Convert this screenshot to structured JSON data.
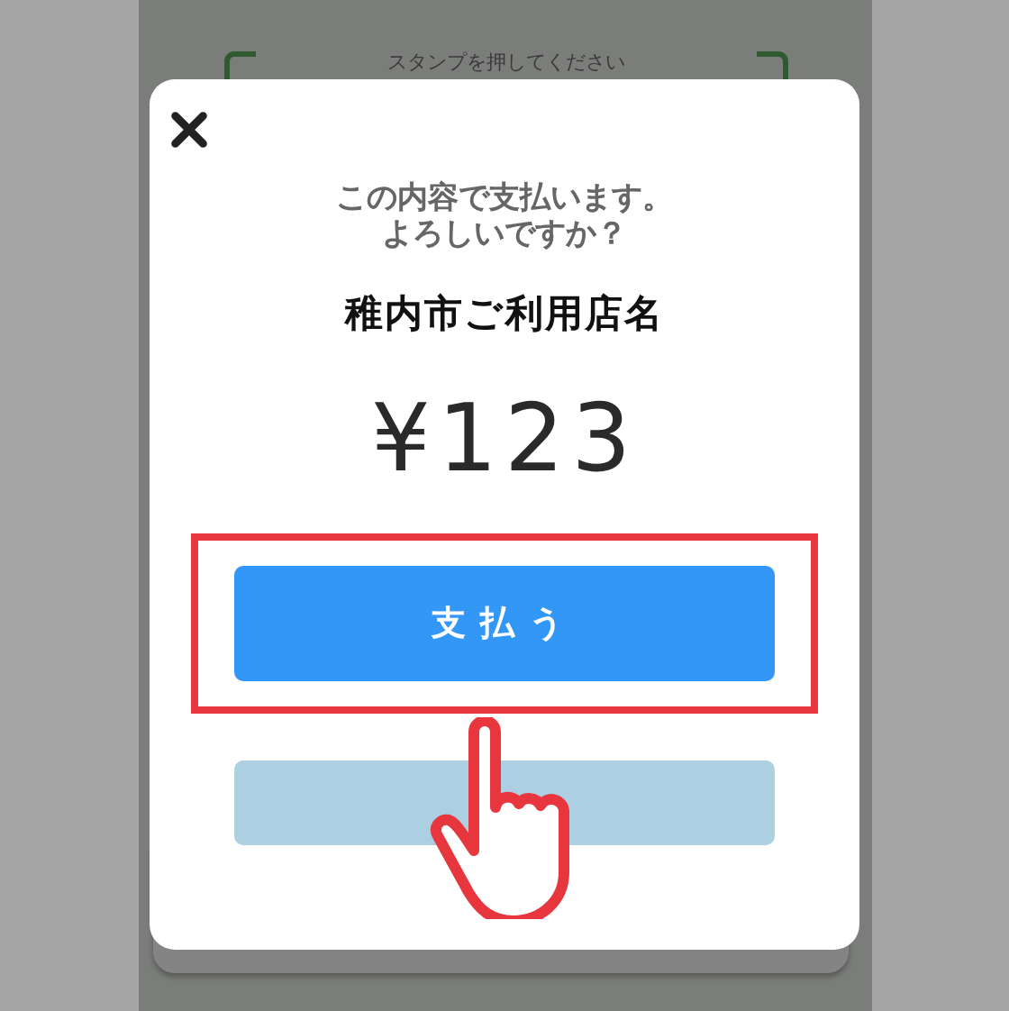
{
  "background": {
    "stamp_prompt": "スタンプを押してください"
  },
  "dialog": {
    "message_lines": [
      "この内容で支払います。",
      "よろしいですか？"
    ],
    "store_name": "稚内市ご利用店名",
    "amount": "¥123",
    "buttons": [
      {
        "kind": "primary",
        "label": "支払う",
        "highlighted": true
      },
      {
        "kind": "secondary",
        "highlighted": false
      }
    ]
  }
}
